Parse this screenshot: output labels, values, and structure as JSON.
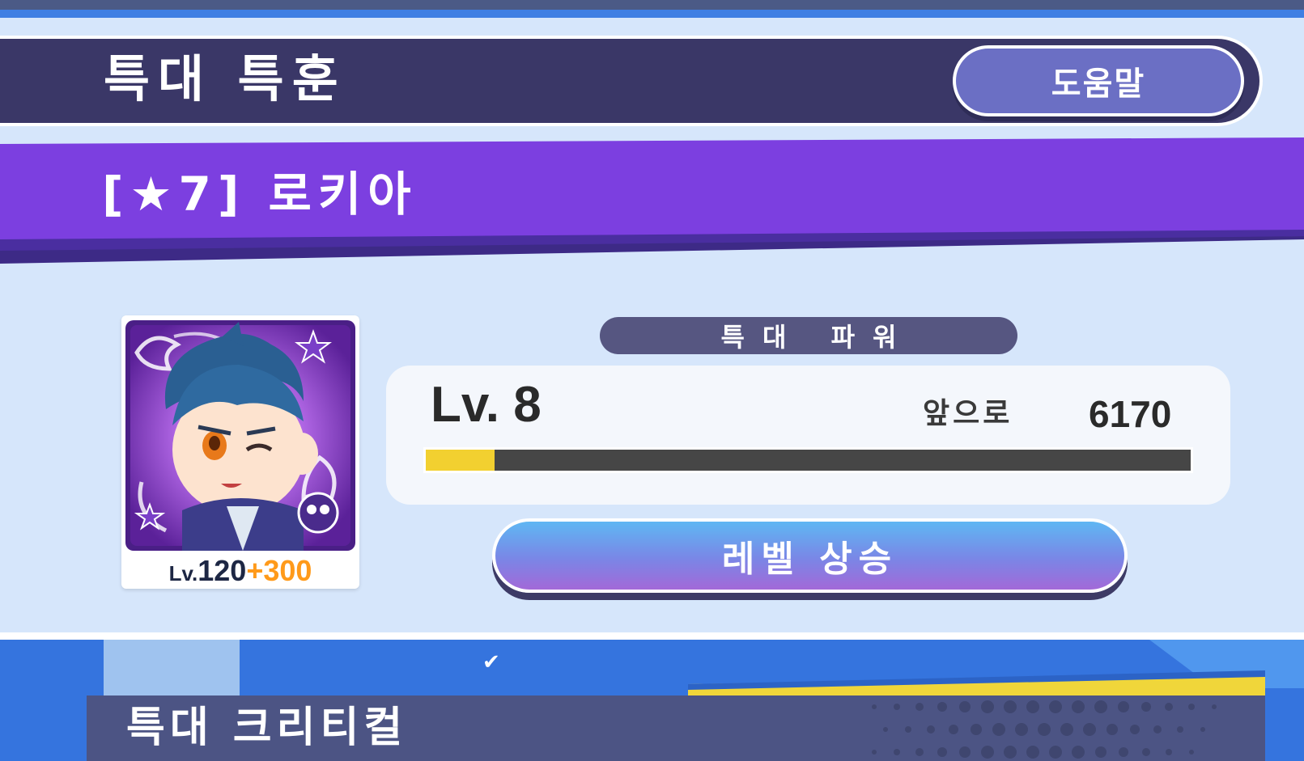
{
  "header": {
    "title": "특대 특훈",
    "help_label": "도움말"
  },
  "character": {
    "name_label": "[★7] 로키아",
    "level_prefix": "Lv.",
    "level": "120",
    "level_bonus": "+300"
  },
  "power": {
    "label": "특대 파워",
    "level_label": "Lv. 8",
    "remaining_label": "앞으로",
    "remaining_value": "6170",
    "progress_fraction": 0.09
  },
  "actions": {
    "level_up_label": "레벨 상승"
  },
  "next_section": {
    "title": "특대 크리티컬"
  },
  "colors": {
    "header_bg": "#3a3767",
    "banner_purple": "#7c3fe0",
    "progress_fill": "#f2d030",
    "bonus_orange": "#ff9a1a"
  }
}
